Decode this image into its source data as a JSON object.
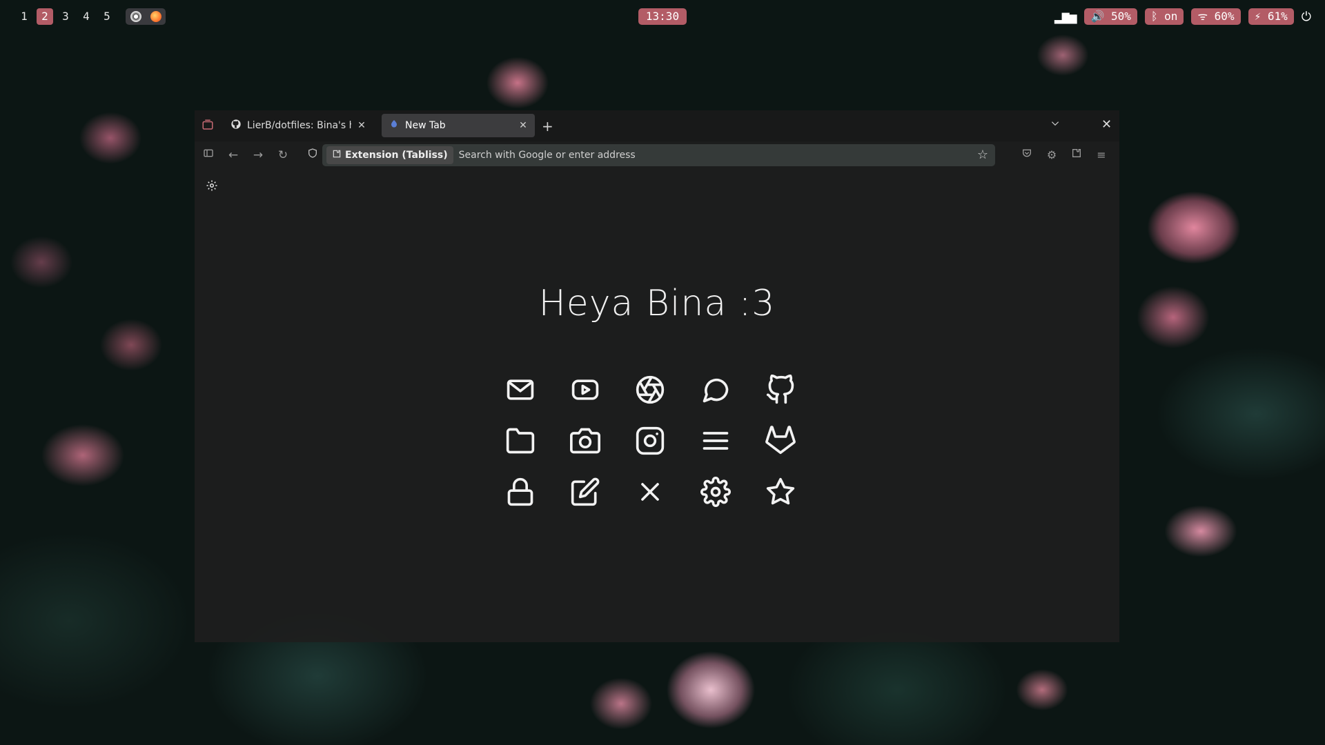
{
  "topbar": {
    "workspaces": [
      "1",
      "2",
      "3",
      "4",
      "5"
    ],
    "active_workspace": "2",
    "clock": "13:30",
    "volume": "🔊 50%",
    "bluetooth": "ᛒ on",
    "wifi": "ᯤ 60%",
    "battery": "⚡ 61%",
    "accent_color": "#b35c66"
  },
  "browser": {
    "tabs": [
      {
        "label": "LierB/dotfiles: Bina's hypr",
        "icon": "github-icon"
      },
      {
        "label": "New Tab",
        "icon": "tabliss-icon"
      }
    ],
    "extension_chip": "Extension (Tabliss)",
    "url_placeholder": "Search with Google or enter address"
  },
  "newtab": {
    "greeting": "Heya Bina :3",
    "links": [
      [
        "mail-icon",
        "youtube-icon",
        "aperture-icon",
        "chat-icon",
        "github-icon"
      ],
      [
        "folder-icon",
        "camera-icon",
        "instagram-icon",
        "menu-icon",
        "gitlab-icon"
      ],
      [
        "lock-icon",
        "edit-icon",
        "close-icon",
        "settings-icon",
        "star-icon"
      ]
    ]
  }
}
